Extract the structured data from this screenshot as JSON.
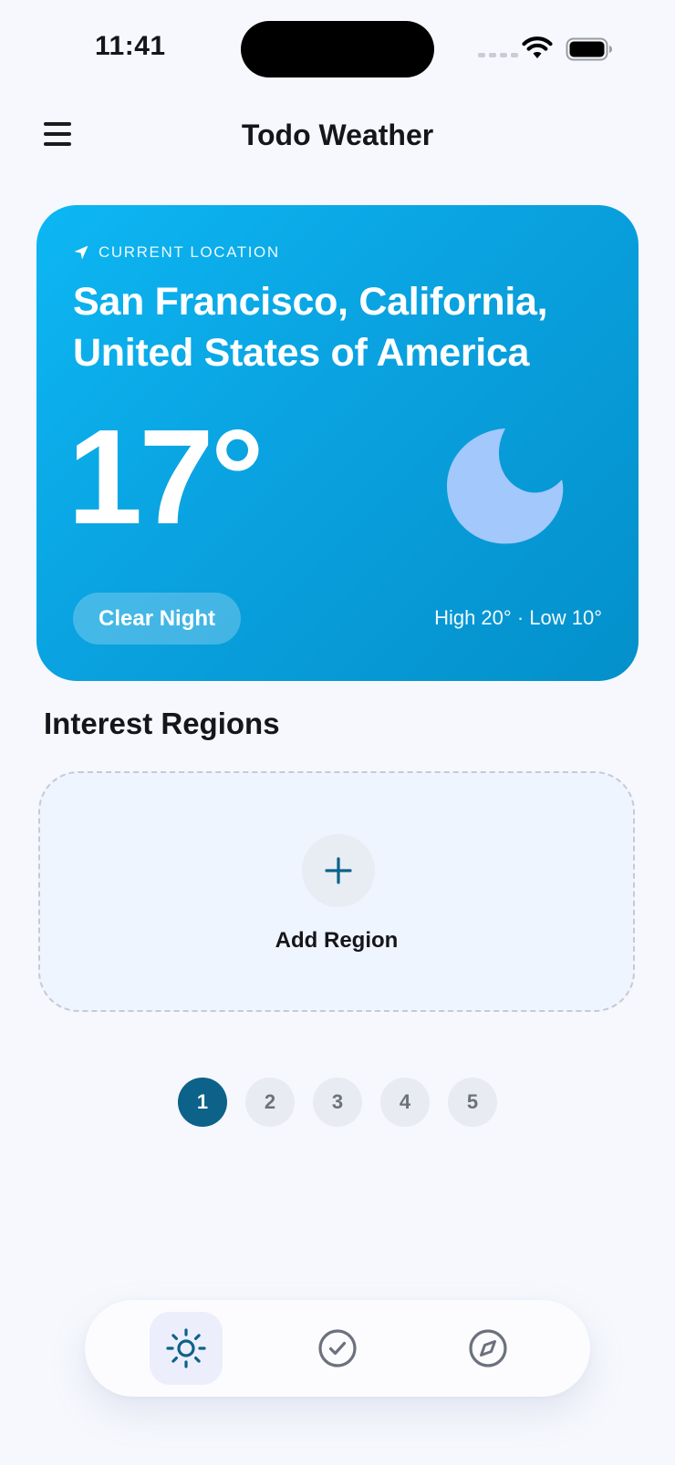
{
  "status_bar": {
    "time": "11:41"
  },
  "header": {
    "title": "Todo Weather",
    "menu_icon": "hamburger-menu-icon"
  },
  "current_weather": {
    "location_label": "CURRENT LOCATION",
    "city": "San Francisco, California, United States of America",
    "temperature": "17°",
    "condition": "Clear Night",
    "high_low": "High 20° · Low 10°",
    "icon": "moon-icon",
    "colors": {
      "card_gradient_start": "#0cb7f3",
      "card_gradient_end": "#0390cb",
      "moon": "#a3c8fb"
    }
  },
  "regions": {
    "title": "Interest Regions",
    "add_label": "Add Region"
  },
  "pagination": {
    "pages": [
      "1",
      "2",
      "3",
      "4",
      "5"
    ],
    "active": "1",
    "active_color": "#0c6288"
  },
  "bottom_nav": {
    "items": [
      {
        "icon": "sun-icon",
        "active": true
      },
      {
        "icon": "check-circle-icon",
        "active": false
      },
      {
        "icon": "compass-icon",
        "active": false
      }
    ]
  }
}
